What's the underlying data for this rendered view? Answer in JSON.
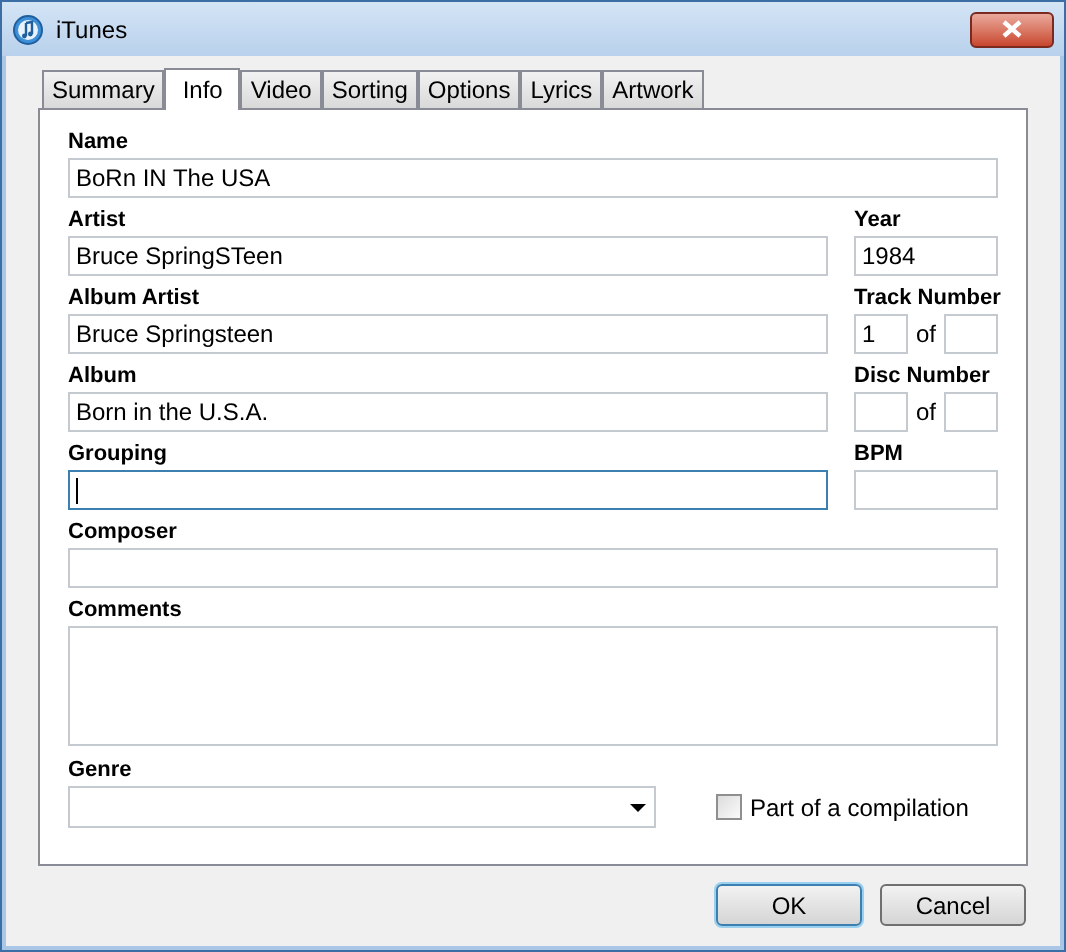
{
  "window": {
    "title": "iTunes"
  },
  "tabs": [
    {
      "label": "Summary",
      "selected": false
    },
    {
      "label": "Info",
      "selected": true
    },
    {
      "label": "Video",
      "selected": false
    },
    {
      "label": "Sorting",
      "selected": false
    },
    {
      "label": "Options",
      "selected": false
    },
    {
      "label": "Lyrics",
      "selected": false
    },
    {
      "label": "Artwork",
      "selected": false
    }
  ],
  "rows": [
    {
      "main": {
        "kind": "line",
        "label": "Name",
        "value": "BoRn IN The USA",
        "focused": false
      }
    },
    {
      "main": {
        "kind": "line",
        "label": "Artist",
        "value": "Bruce SpringSTeen",
        "focused": false
      },
      "side": {
        "kind": "single",
        "label": "Year",
        "value": "1984"
      }
    },
    {
      "main": {
        "kind": "line",
        "label": "Album Artist",
        "value": "Bruce Springsteen",
        "focused": false
      },
      "side": {
        "kind": "pair",
        "label": "Track Number",
        "value": "1",
        "separator": "of"
      }
    },
    {
      "main": {
        "kind": "line",
        "label": "Album",
        "value": "Born in the U.S.A.",
        "focused": false
      },
      "side": {
        "kind": "pair",
        "label": "Disc Number",
        "separator": "of"
      }
    },
    {
      "main": {
        "kind": "line",
        "label": "Grouping",
        "focused": true
      },
      "side": {
        "kind": "single",
        "label": "BPM"
      }
    },
    {
      "main": {
        "kind": "line",
        "label": "Composer",
        "focused": false
      }
    },
    {
      "main": {
        "kind": "multiline",
        "label": "Comments",
        "focused": false
      }
    }
  ],
  "genre": {
    "label": "Genre"
  },
  "compilation": {
    "label": "Part of a compilation",
    "checked": false
  },
  "buttons": [
    {
      "label": "OK",
      "default": true
    },
    {
      "label": "Cancel",
      "default": false
    }
  ]
}
